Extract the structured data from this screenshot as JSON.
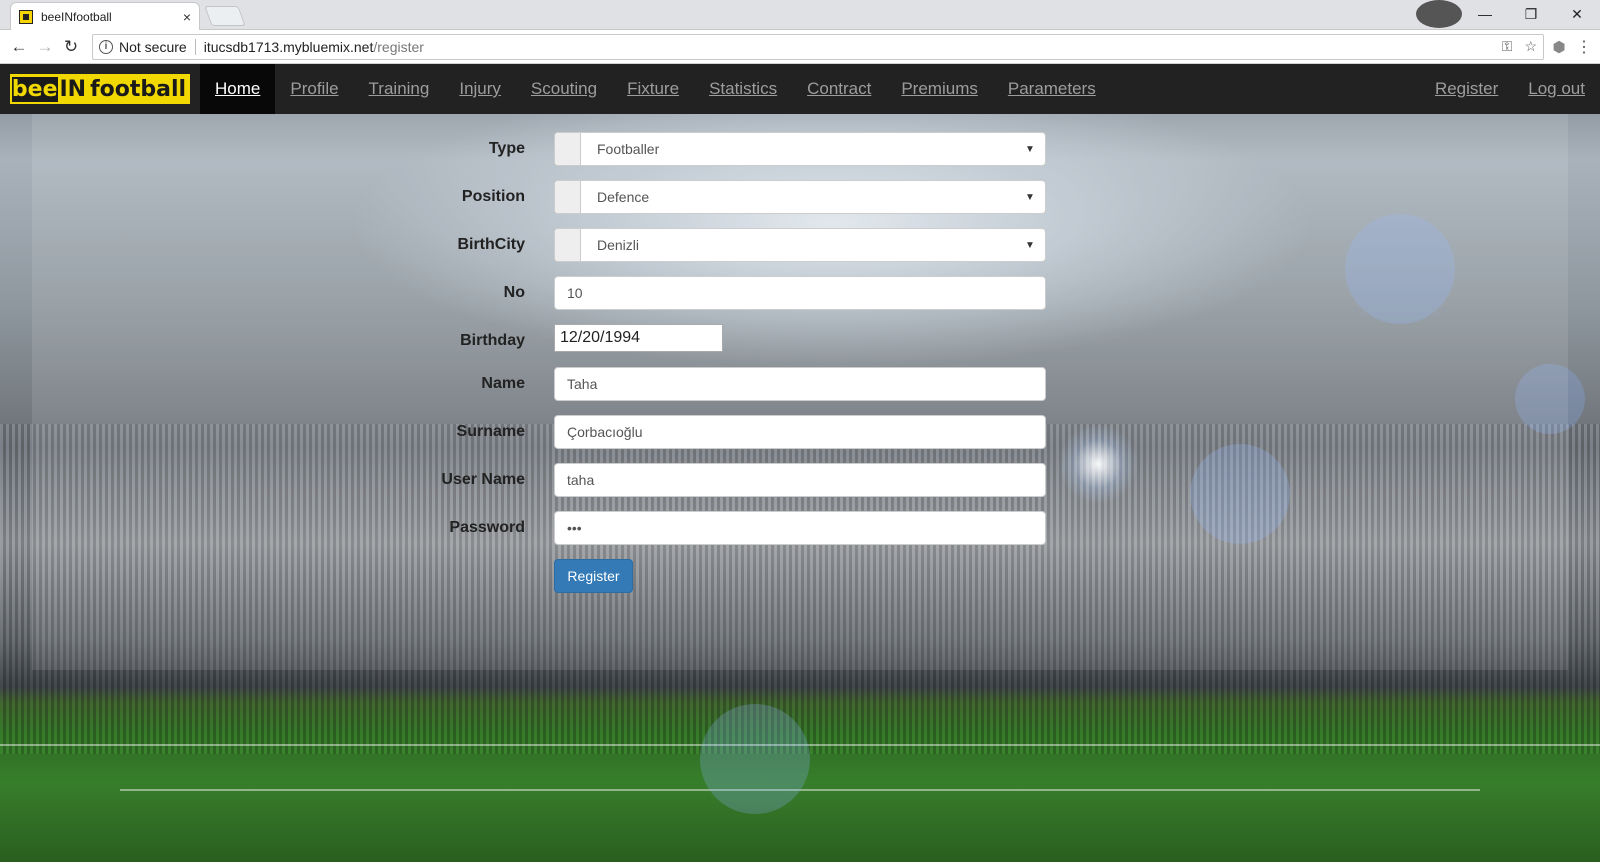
{
  "browser": {
    "tab_title": "beeINfootball",
    "tab_close": "×",
    "security_label": "Not secure",
    "url_host": "itucsdb1713.mybluemix.net",
    "url_path": "/register"
  },
  "navbar": {
    "brand_part1": "bee",
    "brand_part2": "IN",
    "brand_part3": "football",
    "links": [
      "Home",
      "Profile",
      "Training",
      "Injury",
      "Scouting",
      "Fixture",
      "Statistics",
      "Contract",
      "Premiums",
      "Parameters"
    ],
    "active": "Home",
    "right_links": [
      "Register",
      "Log out"
    ]
  },
  "form": {
    "type_label": "Type",
    "type_value": "Footballer",
    "position_label": "Position",
    "position_value": "Defence",
    "birthcity_label": "BirthCity",
    "birthcity_value": "Denizli",
    "no_label": "No",
    "no_value": "10",
    "birthday_label": "Birthday",
    "birthday_value": "12/20/1994",
    "name_label": "Name",
    "name_value": "Taha",
    "surname_label": "Surname",
    "surname_value": "Çorbacıoğlu",
    "username_label": "User Name",
    "username_value": "taha",
    "password_label": "Password",
    "password_value": "•••",
    "submit_label": "Register"
  },
  "colors": {
    "navbar_bg": "#222222",
    "brand_yellow": "#f0d800",
    "button_blue": "#337ab7"
  }
}
